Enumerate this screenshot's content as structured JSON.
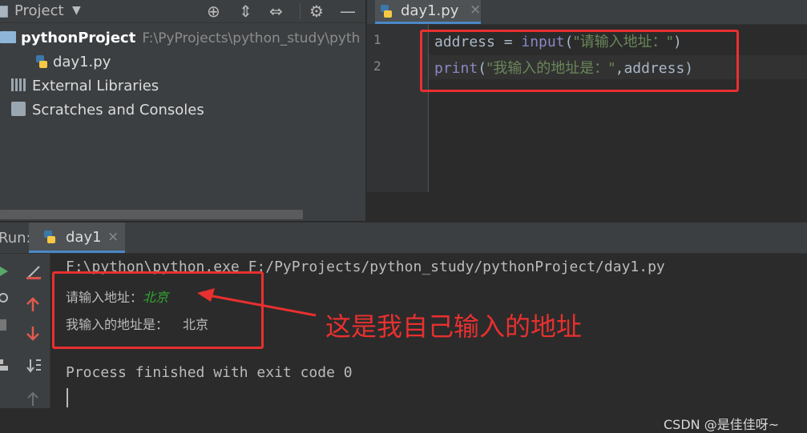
{
  "project_panel": {
    "title": "Project",
    "dropdown": "▼",
    "toolbar_icons": [
      "⊕",
      "⇕",
      "⇔",
      "⚙",
      "—"
    ],
    "tree": {
      "project_name": "pythonProject",
      "project_path": "F:\\PyProjects\\python_study\\pyth",
      "file": "day1.py",
      "external_libraries": "External Libraries",
      "scratches": "Scratches and Consoles"
    }
  },
  "editor": {
    "tab_label": "day1.py",
    "tab_close": "×",
    "line_numbers": [
      "1",
      "2"
    ],
    "line1": {
      "var": "address",
      "op": " = ",
      "fn": "input",
      "open": "(",
      "str": "\"请输入地址：\"",
      "close": ")"
    },
    "line2": {
      "fn": "print",
      "open": "(",
      "str": "\"我输入的地址是：\"",
      "comma": ",",
      "var": "address",
      "close": ")"
    }
  },
  "run_panel": {
    "label": "Run:",
    "tab_label": "day1",
    "tab_close": "×",
    "console": {
      "command": "F:\\python\\python.exe F:/PyProjects/python_study/pythonProject/day1.py",
      "prompt": "请输入地址：",
      "user_input": "北京",
      "output_label": "我输入的地址是：",
      "output_value": "北京",
      "exit_message": "Process finished with exit code 0"
    }
  },
  "annotation": {
    "text": "这是我自己输入的地址",
    "color": "#e8302f"
  },
  "watermark": "CSDN @是佳佳呀~"
}
